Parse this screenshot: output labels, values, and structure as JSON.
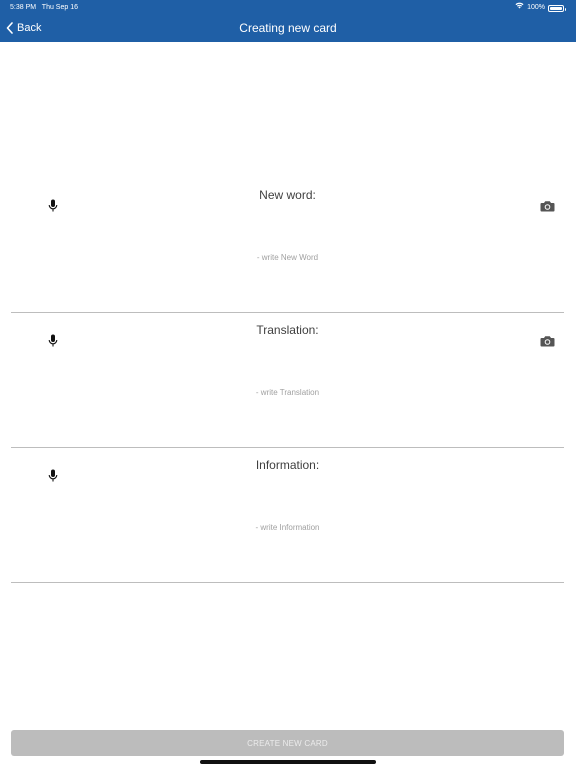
{
  "status_bar": {
    "time": "5:38 PM",
    "date": "Thu Sep 16",
    "battery": "100%"
  },
  "nav": {
    "back_label": "Back",
    "title": "Creating new card"
  },
  "fields": [
    {
      "label": "New word:",
      "placeholder": "- write New Word",
      "value": "",
      "has_camera": true
    },
    {
      "label": "Translation:",
      "placeholder": "- write Translation",
      "value": "",
      "has_camera": true
    },
    {
      "label": "Information:",
      "placeholder": "- write Information",
      "value": "",
      "has_camera": false
    }
  ],
  "icons": {
    "mic": "microphone-icon",
    "camera": "camera-icon",
    "back": "chevron-left-icon",
    "wifi": "wifi-icon",
    "battery": "battery-icon"
  },
  "create_button": {
    "label": "CREATE NEW CARD",
    "enabled": false
  },
  "colors": {
    "nav_bar": "#1f5fa6",
    "button_disabled": "#bcbcbc",
    "divider": "#bdbdbd"
  }
}
